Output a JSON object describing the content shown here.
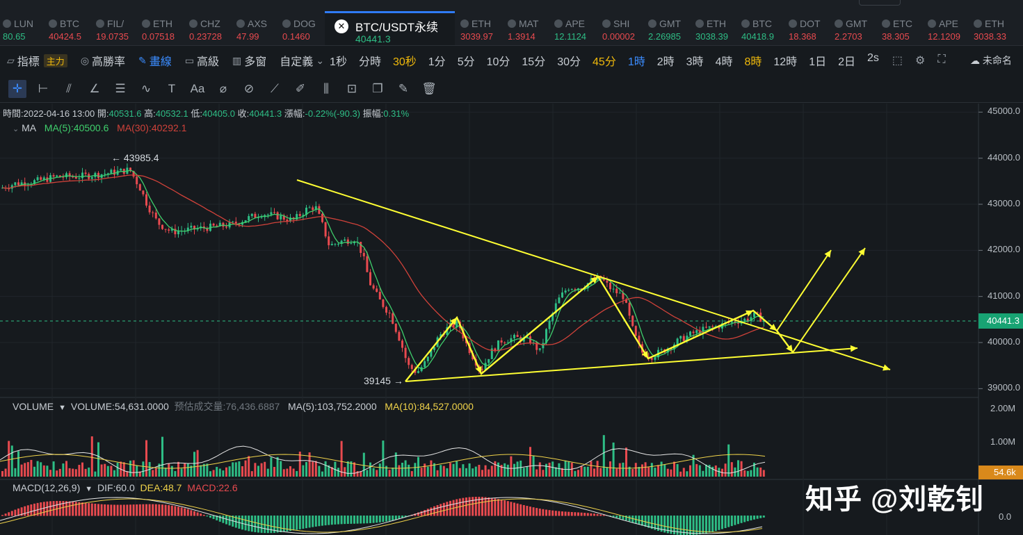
{
  "tickers": [
    {
      "name": "LUN",
      "value": "80.65",
      "dir": "up"
    },
    {
      "name": "BTC",
      "value": "40424.5",
      "dir": "down"
    },
    {
      "name": "FIL/",
      "value": "19.0735",
      "dir": "down"
    },
    {
      "name": "ETH",
      "value": "0.07518",
      "dir": "down"
    },
    {
      "name": "CHZ",
      "value": "0.23728",
      "dir": "down"
    },
    {
      "name": "AXS",
      "value": "47.99",
      "dir": "down"
    },
    {
      "name": "DOG",
      "value": "0.1460",
      "dir": "down"
    },
    {
      "name": "ETH",
      "value": "3039.97",
      "dir": "down"
    },
    {
      "name": "MAT",
      "value": "1.3914",
      "dir": "down"
    },
    {
      "name": "APE",
      "value": "12.1124",
      "dir": "up"
    },
    {
      "name": "SHI",
      "value": "0.00002",
      "dir": "down"
    },
    {
      "name": "GMT",
      "value": "2.26985",
      "dir": "up"
    },
    {
      "name": "ETH",
      "value": "3038.39",
      "dir": "up"
    },
    {
      "name": "BTC",
      "value": "40418.9",
      "dir": "up"
    },
    {
      "name": "DOT",
      "value": "18.368",
      "dir": "down"
    },
    {
      "name": "GMT",
      "value": "2.2703",
      "dir": "down"
    },
    {
      "name": "ETC",
      "value": "38.305",
      "dir": "down"
    },
    {
      "name": "APE",
      "value": "12.1209",
      "dir": "down"
    },
    {
      "name": "ETH",
      "value": "3038.33",
      "dir": "down"
    }
  ],
  "active_pair": {
    "name": "BTC/USDT永续",
    "price": "40441.3"
  },
  "toolbar": {
    "indicator": "指標",
    "indicator_badge": "主力",
    "high_win": "高勝率",
    "draw": "畫線",
    "advanced": "高級",
    "multi": "多窗",
    "custom": "自定義",
    "intervals": [
      "1秒",
      "分時",
      "30秒",
      "1分",
      "5分",
      "10分",
      "15分",
      "30分",
      "45分",
      "1時",
      "2時",
      "3時",
      "4時",
      "8時",
      "12時",
      "1日",
      "2日",
      "2s"
    ],
    "highlighted_intervals": [
      "30秒",
      "45分",
      "8時"
    ],
    "selected_interval": "1時",
    "layout_name": "未命名"
  },
  "info": {
    "time_label": "時間:",
    "time": "2022-04-16 13:00",
    "open_label": "開:",
    "open": "40531.6",
    "high_label": "高:",
    "high": "40532.1",
    "low_label": "低:",
    "low": "40405.0",
    "close_label": "收:",
    "close": "40441.3",
    "change_label": "漲幅:",
    "change": "-0.22%(-90.3)",
    "amp_label": "振幅:",
    "amp": "0.31%"
  },
  "ma": {
    "label": "MA",
    "ma5": "MA(5):40500.6",
    "ma30": "MA(30):40292.1"
  },
  "volume": {
    "label": "VOLUME",
    "value": "VOLUME:54,631.0000",
    "estimate": "预估成交量:76,436.6887",
    "ma5": "MA(5):103,752.2000",
    "ma10": "MA(10):84,527.0000",
    "tag": "54.6k"
  },
  "macd": {
    "label": "MACD(12,26,9)",
    "dif": "DIF:60.0",
    "dea": "DEA:48.7",
    "macd": "MACD:22.6"
  },
  "price_axis": [
    "45000.0",
    "44000.0",
    "43000.0",
    "42000.0",
    "41000.0",
    "40000.0",
    "39000.0"
  ],
  "volume_axis": [
    "2.00M",
    "1.00M"
  ],
  "macd_axis": [
    "0.0"
  ],
  "current_price_tag": "40441.3",
  "annotations": {
    "high": "← 43985.4",
    "low": "39145 →"
  },
  "watermark": "知乎 @刘乾钊",
  "colors": {
    "up": "#2ebd85",
    "down": "#e84a4f",
    "accent": "#3b8cff",
    "drawing": "#ffff33",
    "ma5": "#3fcf6c",
    "ma30": "#d0423a"
  }
}
